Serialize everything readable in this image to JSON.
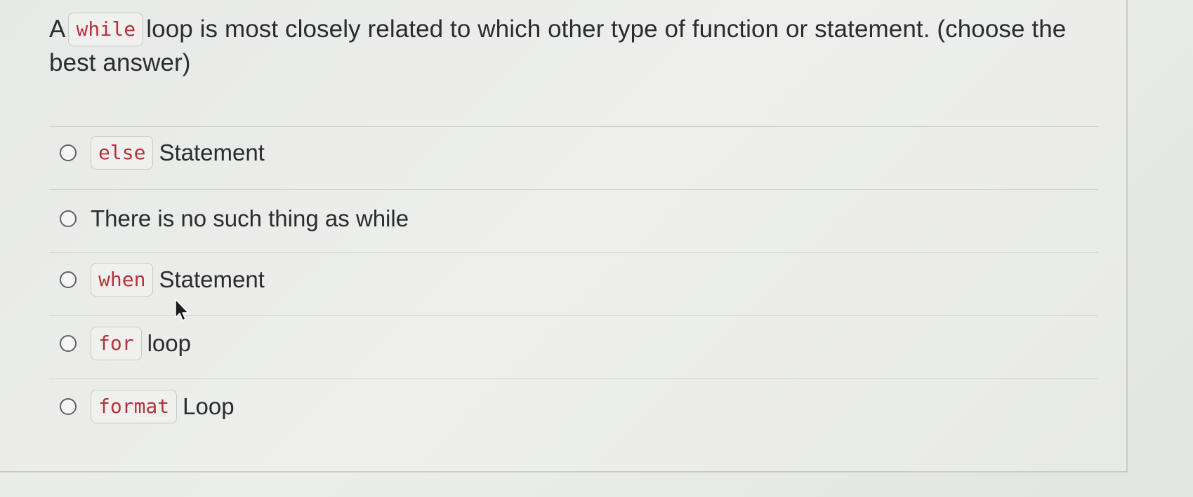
{
  "question": {
    "prefix": "A",
    "code": "while",
    "suffix": "loop is most closely related to which other type of function or statement. (choose the best answer)"
  },
  "options": [
    {
      "code": "else",
      "text": "Statement"
    },
    {
      "code": "",
      "text": "There is no such thing as while"
    },
    {
      "code": "when",
      "text": "Statement"
    },
    {
      "code": "for",
      "text": "loop"
    },
    {
      "code": "format",
      "text": "Loop"
    }
  ],
  "colors": {
    "code_text": "#b3333a",
    "body_text": "#2a2c2e",
    "divider": "#cfd1cf"
  },
  "icons": {
    "cursor": "mouse-pointer-icon",
    "radio": "radio-button-icon"
  }
}
